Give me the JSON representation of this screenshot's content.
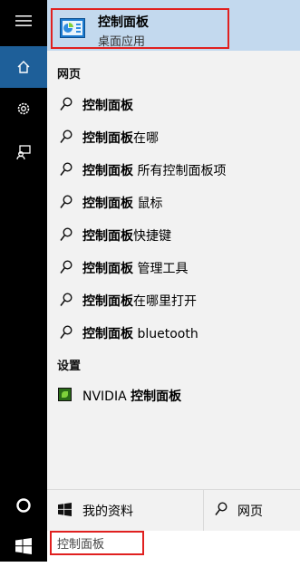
{
  "best_match": {
    "title": "控制面板",
    "subtitle": "桌面应用",
    "icon": "control-panel-icon"
  },
  "sections": {
    "web": "网页",
    "settings": "设置"
  },
  "suggestions": [
    {
      "bold": "控制面板",
      "rest": ""
    },
    {
      "bold": "控制面板",
      "rest": "在哪"
    },
    {
      "bold": "控制面板",
      "rest": " 所有控制面板项"
    },
    {
      "bold": "控制面板",
      "rest": " 鼠标"
    },
    {
      "bold": "控制面板",
      "rest": "快捷键"
    },
    {
      "bold": "控制面板",
      "rest": " 管理工具"
    },
    {
      "bold": "控制面板",
      "rest": "在哪里打开"
    },
    {
      "bold": "控制面板",
      "rest": " bluetooth"
    }
  ],
  "settings_item": {
    "prefix": "NVIDIA ",
    "bold": "控制面板",
    "icon": "nvidia-icon"
  },
  "bottom_tabs": {
    "my_stuff": "我的资料",
    "web": "网页"
  },
  "search": {
    "value": "控制面板"
  },
  "rail_icons": [
    "hamburger-icon",
    "home-icon",
    "gear-icon",
    "feedback-icon",
    "cortana-icon",
    "windows-logo-icon"
  ],
  "colors": {
    "rail": "#000000",
    "active_rail": "#1e5f99",
    "best_match_bg": "#c3d9ee",
    "panel_bg": "#f2f2f2",
    "highlight_box": "#e0201f"
  }
}
